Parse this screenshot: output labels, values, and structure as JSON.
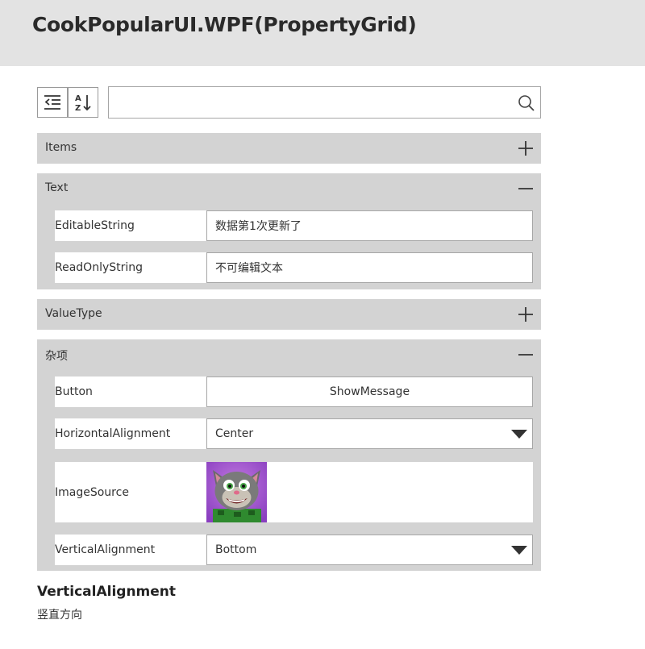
{
  "window": {
    "title": "CookPopularUI.WPF(PropertyGrid)"
  },
  "toolbar": {
    "categorized_icon": "categorized-list-icon",
    "alphabetical_icon": "sort-az-icon",
    "search_value": "",
    "search_icon": "search-icon"
  },
  "categories": {
    "items": {
      "label": "Items",
      "expanded": false
    },
    "text": {
      "label": "Text",
      "expanded": true,
      "editable_string": {
        "label": "EditableString",
        "value": "数据第1次更新了"
      },
      "readonly_string": {
        "label": "ReadOnlyString",
        "value": "不可编辑文本"
      }
    },
    "value_type": {
      "label": "ValueType",
      "expanded": false
    },
    "misc": {
      "label": "杂项",
      "expanded": true,
      "button": {
        "label": "Button",
        "button_text": "ShowMessage"
      },
      "horizontal_alignment": {
        "label": "HorizontalAlignment",
        "value": "Center"
      },
      "image_source": {
        "label": "ImageSource"
      },
      "vertical_alignment": {
        "label": "VerticalAlignment",
        "value": "Bottom"
      }
    }
  },
  "description": {
    "title": "VerticalAlignment",
    "text": "竖直方向"
  },
  "colors": {
    "header_bg": "#e3e3e3",
    "category_bg": "#d3d3d3",
    "border": "#a6a6a6"
  }
}
